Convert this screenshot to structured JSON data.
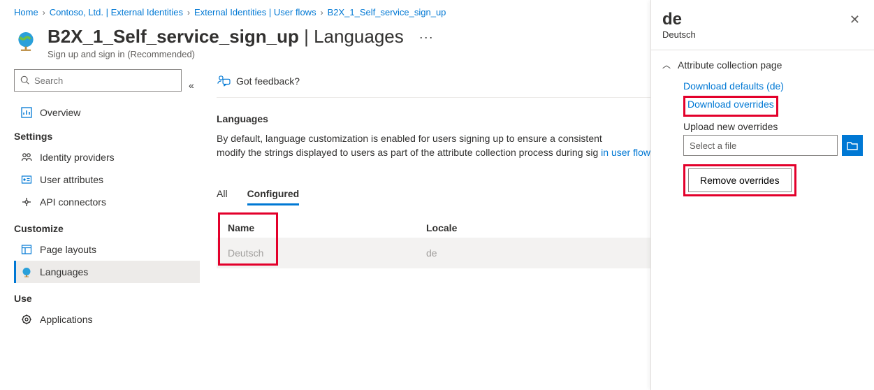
{
  "breadcrumb": {
    "items": [
      "Home",
      "Contoso, Ltd. | External Identities",
      "External Identities | User flows",
      "B2X_1_Self_service_sign_up"
    ]
  },
  "header": {
    "title_prefix": "B2X_1_Self_service_sign_up",
    "title_suffix": " | Languages",
    "subtitle": "Sign up and sign in (Recommended)"
  },
  "leftnav": {
    "search_placeholder": "Search",
    "overview": "Overview",
    "groups": {
      "settings": {
        "title": "Settings",
        "items": [
          "Identity providers",
          "User attributes",
          "API connectors"
        ]
      },
      "customize": {
        "title": "Customize",
        "items": [
          "Page layouts",
          "Languages"
        ]
      },
      "use": {
        "title": "Use",
        "items": [
          "Applications"
        ]
      }
    }
  },
  "main": {
    "feedback": "Got feedback?",
    "section_title": "Languages",
    "section_desc_1": "By default, language customization is enabled for users signing up to ensure a consistent",
    "section_desc_2": "modify the strings displayed to users as part of the attribute collection process during sig",
    "section_link": "in user flows.",
    "tabs": {
      "all": "All",
      "configured": "Configured"
    },
    "table": {
      "cols": {
        "name": "Name",
        "locale": "Locale"
      },
      "rows": [
        {
          "name": "Deutsch",
          "locale": "de"
        }
      ]
    }
  },
  "panel": {
    "title": "de",
    "subtitle": "Deutsch",
    "section_title": "Attribute collection page",
    "download_defaults": "Download defaults (de)",
    "download_overrides": "Download overrides",
    "upload_label": "Upload new overrides",
    "file_placeholder": "Select a file",
    "remove_overrides": "Remove overrides"
  }
}
